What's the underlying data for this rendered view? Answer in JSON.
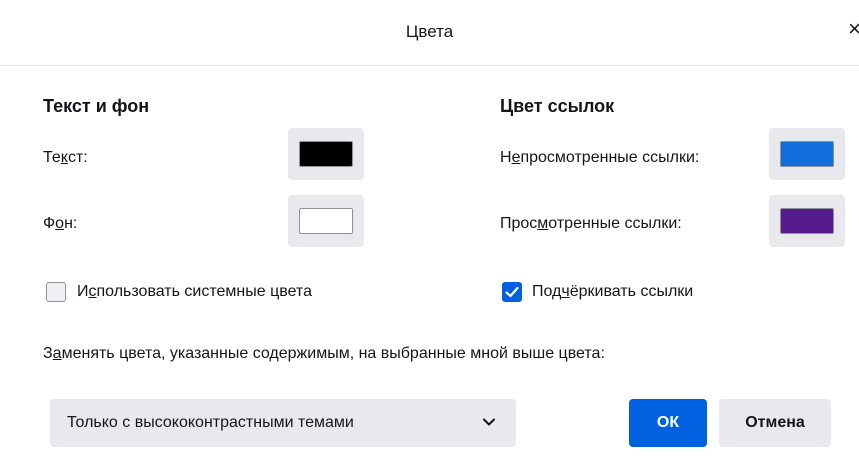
{
  "dialog": {
    "title": "Цвета",
    "close_label": "×"
  },
  "text_and_background": {
    "heading": "Текст и фон",
    "text": {
      "label_pre": "Те",
      "label_key": "к",
      "label_post": "ст:",
      "color": "#000000"
    },
    "background": {
      "label_pre": "Ф",
      "label_key": "о",
      "label_post": "н:",
      "color": "#ffffff"
    },
    "use_system_colors": {
      "label_pre": "И",
      "label_key": "с",
      "label_post": "пользовать системные цвета",
      "checked": false
    }
  },
  "link_colors": {
    "heading": "Цвет ссылок",
    "unvisited": {
      "label_pre": "Н",
      "label_key": "е",
      "label_post": "просмотренные ссылки:",
      "color": "#0f6ddc"
    },
    "visited": {
      "label_pre": "Прос",
      "label_key": "м",
      "label_post": "отренные ссылки:",
      "color": "#551a8b"
    },
    "underline_links": {
      "label_pre": "Под",
      "label_key": "ч",
      "label_post": "ёркивать ссылки",
      "checked": true
    }
  },
  "override": {
    "label_pre": "З",
    "label_key": "а",
    "label_post": "менять цвета, указанные содержимым, на выбранные мной выше цвета:",
    "selected": "Только с высококонтрастными темами"
  },
  "buttons": {
    "ok": "ОК",
    "cancel": "Отмена"
  },
  "colors": {
    "accent": "#0061e0",
    "button_bg": "#e9e9ed"
  }
}
